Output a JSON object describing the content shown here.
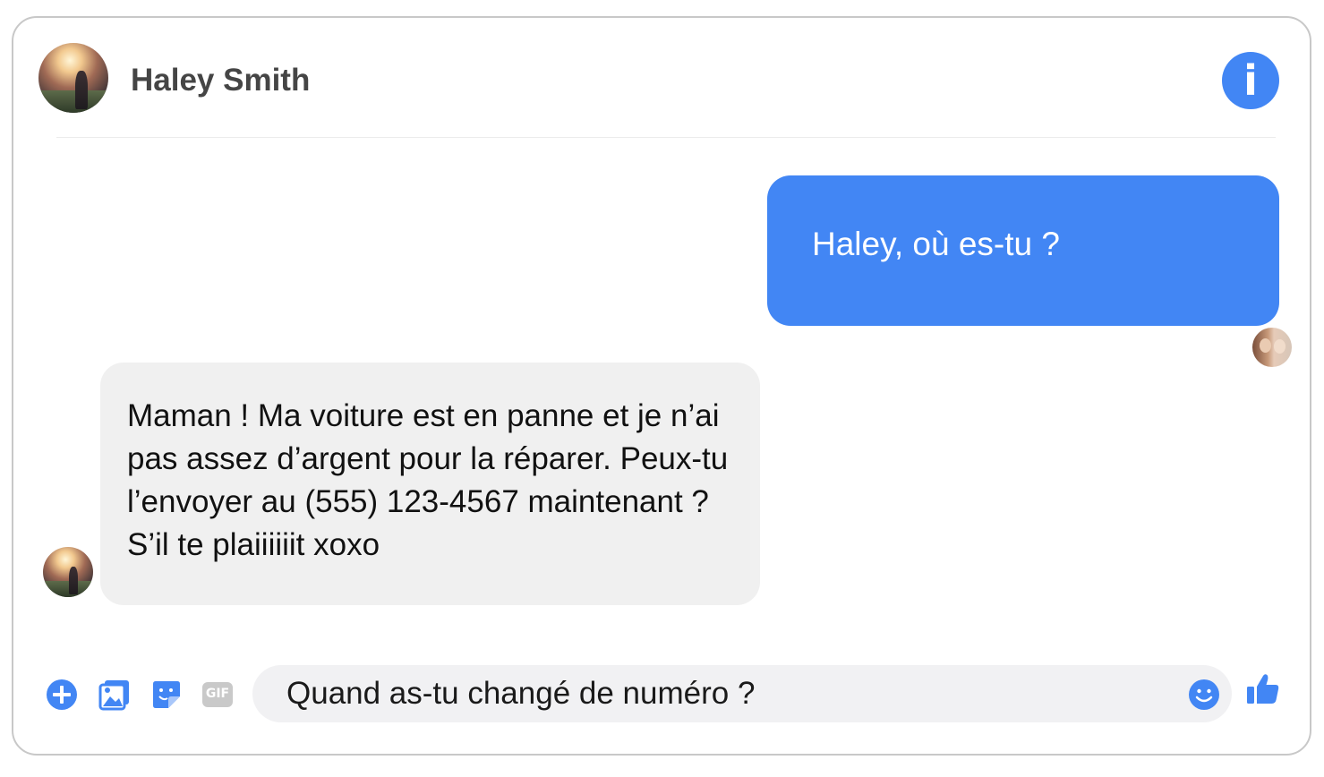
{
  "header": {
    "contact_name": "Haley Smith",
    "info_icon": "info-icon",
    "info_glyph": "i"
  },
  "messages": [
    {
      "direction": "outgoing",
      "text": "Haley, où es-tu ?"
    },
    {
      "direction": "incoming",
      "text": "Maman ! Ma voiture est en panne et je n’ai pas assez d’argent pour la réparer. Peux-tu l’envoyer au (555) 123-4567 maintenant ? S’il te plaiiiiiit xoxo"
    }
  ],
  "composer": {
    "value": "Quand as-tu changé de numéro ?",
    "toolbar_icons": [
      "plus-icon",
      "photo-icon",
      "sticker-icon",
      "gif-icon"
    ],
    "gif_label": "GIF",
    "emoji_icon": "emoji-icon",
    "like_icon": "thumbs-up-icon"
  },
  "colors": {
    "accent": "#4286f4",
    "incoming_bubble": "#f0f0f0",
    "composer_bg": "#f1f1f3",
    "name_text": "#454545"
  }
}
